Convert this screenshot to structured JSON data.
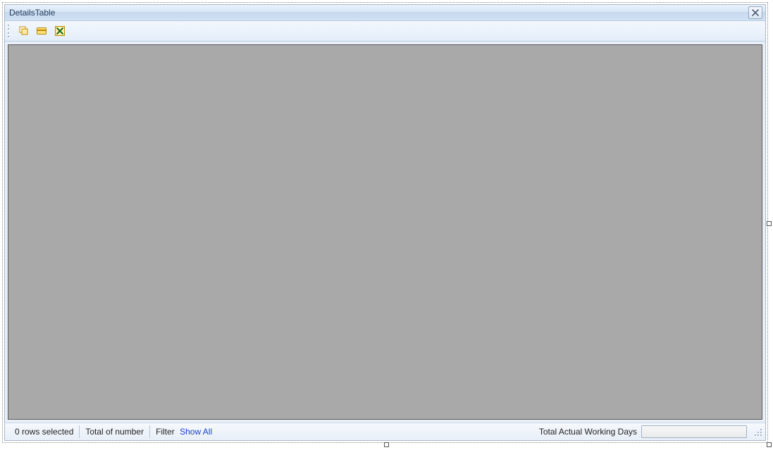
{
  "title": "DetailsTable",
  "toolbar": {
    "buttons": [
      {
        "name": "copy-icon"
      },
      {
        "name": "card-icon"
      },
      {
        "name": "excel-icon"
      }
    ]
  },
  "status": {
    "rows_selected": "0 rows selected",
    "total_number": "Total of number",
    "filter_label": "Filter",
    "filter_link": "Show All",
    "right_label": "Total Actual Working Days",
    "right_value": ""
  }
}
